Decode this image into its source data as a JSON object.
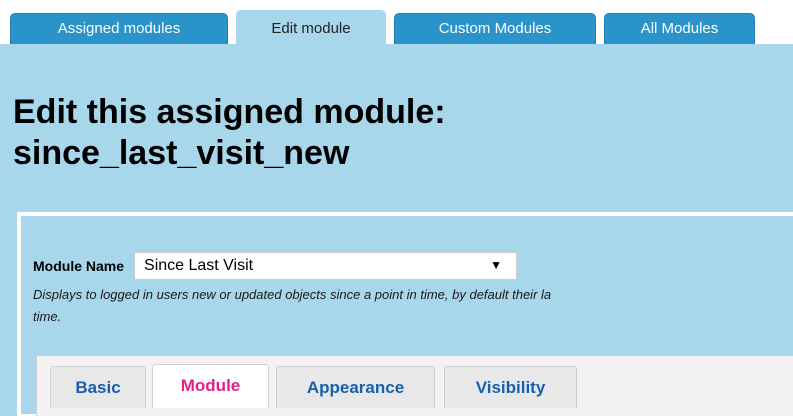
{
  "top_tabs": [
    {
      "label": "Assigned modules",
      "active": false
    },
    {
      "label": "Edit module",
      "active": true
    },
    {
      "label": "Custom Modules",
      "active": false
    },
    {
      "label": "All Modules",
      "active": false
    }
  ],
  "page_title": "Edit this assigned module:\nsince_last_visit_new",
  "module_name": {
    "label": "Module Name",
    "selected": "Since Last Visit",
    "arrow_icon": "dropdown-arrow-icon"
  },
  "description": "Displays to logged in users new or updated objects since a point in time, by default their la\ntime.",
  "sub_tabs": [
    {
      "label": "Basic",
      "active": false
    },
    {
      "label": "Module",
      "active": true
    },
    {
      "label": "Appearance",
      "active": false
    },
    {
      "label": "Visibility",
      "active": false
    }
  ],
  "colors": {
    "panel_bg": "#a8d6eb",
    "tab_bg": "#2a93c9",
    "subtab_text": "#1a5fae",
    "subtab_active_text": "#e0218a"
  }
}
